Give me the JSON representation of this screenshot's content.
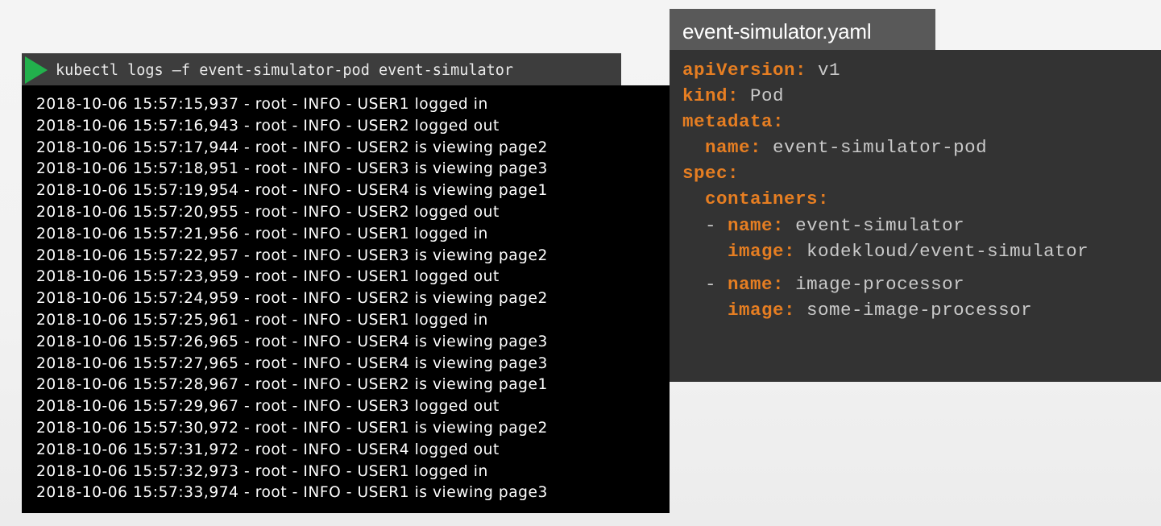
{
  "terminal": {
    "command": "kubectl logs –f event-simulator-pod event-simulator",
    "logs": [
      "2018-10-06 15:57:15,937 - root - INFO - USER1 logged in",
      "2018-10-06 15:57:16,943 - root - INFO - USER2 logged out",
      "2018-10-06 15:57:17,944 - root - INFO - USER2 is viewing page2",
      "2018-10-06 15:57:18,951 - root - INFO - USER3 is viewing page3",
      "2018-10-06 15:57:19,954 - root - INFO - USER4 is viewing page1",
      "2018-10-06 15:57:20,955 - root - INFO - USER2 logged out",
      "2018-10-06 15:57:21,956 - root - INFO - USER1 logged in",
      "2018-10-06 15:57:22,957 - root - INFO - USER3 is viewing page2",
      "2018-10-06 15:57:23,959 - root - INFO - USER1 logged out",
      "2018-10-06 15:57:24,959 - root - INFO - USER2 is viewing page2",
      "2018-10-06 15:57:25,961 - root - INFO - USER1 logged in",
      "2018-10-06 15:57:26,965 - root - INFO - USER4 is viewing page3",
      "2018-10-06 15:57:27,965 - root - INFO - USER4 is viewing page3",
      "2018-10-06 15:57:28,967 - root - INFO - USER2 is viewing page1",
      "2018-10-06 15:57:29,967 - root - INFO - USER3 logged out",
      "2018-10-06 15:57:30,972 - root - INFO - USER1 is viewing page2",
      "2018-10-06 15:57:31,972 - root - INFO - USER4 logged out",
      "2018-10-06 15:57:32,973 - root - INFO - USER1 logged in",
      "2018-10-06 15:57:33,974 - root - INFO - USER1 is viewing page3"
    ]
  },
  "yaml": {
    "filename": "event-simulator.yaml",
    "apiVersion_key": "apiVersion:",
    "apiVersion_value": "v1",
    "kind_key": "kind:",
    "kind_value": "Pod",
    "metadata_key": "metadata:",
    "metadata_name_key": "name:",
    "metadata_name_value": "event-simulator-pod",
    "spec_key": "spec:",
    "containers_key": "containers:",
    "containers": [
      {
        "name_key": "name:",
        "name_value": "event-simulator",
        "image_key": "image:",
        "image_value": "kodekloud/event-simulator"
      },
      {
        "name_key": "name:",
        "name_value": "image-processor",
        "image_key": "image:",
        "image_value": "some-image-processor"
      }
    ]
  },
  "colors": {
    "yaml_key": "#e67e22",
    "yaml_value": "#c9c9c9",
    "play_icon": "#22b14c",
    "terminal_bg": "#000000",
    "yaml_bg": "#333333"
  }
}
